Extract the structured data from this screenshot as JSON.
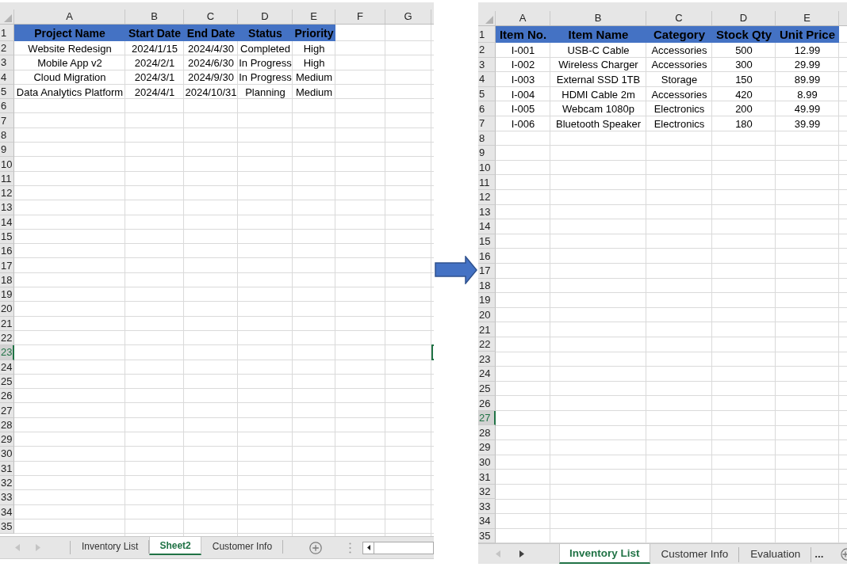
{
  "left_workbook": {
    "column_letters": [
      "A",
      "B",
      "C",
      "D",
      "E",
      "F",
      "G"
    ],
    "row_numbers": [
      {
        "label": "1",
        "selected": false
      },
      {
        "label": "2",
        "selected": false
      },
      {
        "label": "3",
        "selected": false
      },
      {
        "label": "4",
        "selected": false
      },
      {
        "label": "5",
        "selected": false
      },
      {
        "label": "6",
        "selected": false
      },
      {
        "label": "7",
        "selected": false
      },
      {
        "label": "8",
        "selected": false
      },
      {
        "label": "9",
        "selected": false
      },
      {
        "label": "10",
        "selected": false
      },
      {
        "label": "11",
        "selected": false
      },
      {
        "label": "12",
        "selected": false
      },
      {
        "label": "13",
        "selected": false
      },
      {
        "label": "14",
        "selected": false
      },
      {
        "label": "15",
        "selected": false
      },
      {
        "label": "16",
        "selected": false
      },
      {
        "label": "17",
        "selected": false
      },
      {
        "label": "18",
        "selected": false
      },
      {
        "label": "19",
        "selected": false
      },
      {
        "label": "20",
        "selected": false
      },
      {
        "label": "21",
        "selected": false
      },
      {
        "label": "22",
        "selected": false
      },
      {
        "label": "23",
        "selected": true
      },
      {
        "label": "24",
        "selected": false
      },
      {
        "label": "25",
        "selected": false
      },
      {
        "label": "26",
        "selected": false
      },
      {
        "label": "27",
        "selected": false
      },
      {
        "label": "28",
        "selected": false
      },
      {
        "label": "29",
        "selected": false
      },
      {
        "label": "30",
        "selected": false
      },
      {
        "label": "31",
        "selected": false
      },
      {
        "label": "32",
        "selected": false
      },
      {
        "label": "33",
        "selected": false
      },
      {
        "label": "34",
        "selected": false
      },
      {
        "label": "35",
        "selected": false
      }
    ],
    "table": {
      "columns": [
        "Project Name",
        "Start Date",
        "End Date",
        "Status",
        "Priority"
      ],
      "rows": [
        [
          "Website Redesign",
          "2024/1/15",
          "2024/4/30",
          "Completed",
          "High"
        ],
        [
          "Mobile App v2",
          "2024/2/1",
          "2024/6/30",
          "In Progress",
          "High"
        ],
        [
          "Cloud Migration",
          "2024/3/1",
          "2024/9/30",
          "In Progress",
          "Medium"
        ],
        [
          "Data Analytics Platform",
          "2024/4/1",
          "2024/10/31",
          "Planning",
          "Medium"
        ]
      ]
    },
    "active_cell_edge": true,
    "sheet_nav": {
      "prev_disabled": true,
      "next_disabled": true
    },
    "sheet_tabs": [
      {
        "label": "Inventory List",
        "selected": false
      },
      {
        "label": "Sheet2",
        "selected": true
      },
      {
        "label": "Customer Info",
        "selected": false
      }
    ]
  },
  "right_workbook": {
    "column_letters": [
      "A",
      "B",
      "C",
      "D",
      "E"
    ],
    "row_numbers": [
      {
        "label": "1",
        "selected": false
      },
      {
        "label": "2",
        "selected": false
      },
      {
        "label": "3",
        "selected": false
      },
      {
        "label": "4",
        "selected": false
      },
      {
        "label": "5",
        "selected": false
      },
      {
        "label": "6",
        "selected": false
      },
      {
        "label": "7",
        "selected": false
      },
      {
        "label": "8",
        "selected": false
      },
      {
        "label": "9",
        "selected": false
      },
      {
        "label": "10",
        "selected": false
      },
      {
        "label": "11",
        "selected": false
      },
      {
        "label": "12",
        "selected": false
      },
      {
        "label": "13",
        "selected": false
      },
      {
        "label": "14",
        "selected": false
      },
      {
        "label": "15",
        "selected": false
      },
      {
        "label": "16",
        "selected": false
      },
      {
        "label": "17",
        "selected": false
      },
      {
        "label": "18",
        "selected": false
      },
      {
        "label": "19",
        "selected": false
      },
      {
        "label": "20",
        "selected": false
      },
      {
        "label": "21",
        "selected": false
      },
      {
        "label": "22",
        "selected": false
      },
      {
        "label": "23",
        "selected": false
      },
      {
        "label": "24",
        "selected": false
      },
      {
        "label": "25",
        "selected": false
      },
      {
        "label": "26",
        "selected": false
      },
      {
        "label": "27",
        "selected": true
      },
      {
        "label": "28",
        "selected": false
      },
      {
        "label": "29",
        "selected": false
      },
      {
        "label": "30",
        "selected": false
      },
      {
        "label": "31",
        "selected": false
      },
      {
        "label": "32",
        "selected": false
      },
      {
        "label": "33",
        "selected": false
      },
      {
        "label": "34",
        "selected": false
      },
      {
        "label": "35",
        "selected": false
      }
    ],
    "table": {
      "columns": [
        "Item No.",
        "Item Name",
        "Category",
        "Stock Qty",
        "Unit Price"
      ],
      "rows": [
        [
          "I-001",
          "USB-C Cable",
          "Accessories",
          "500",
          "12.99"
        ],
        [
          "I-002",
          "Wireless Charger",
          "Accessories",
          "300",
          "29.99"
        ],
        [
          "I-003",
          "External SSD 1TB",
          "Storage",
          "150",
          "89.99"
        ],
        [
          "I-004",
          "HDMI Cable 2m",
          "Accessories",
          "420",
          "8.99"
        ],
        [
          "I-005",
          "Webcam 1080p",
          "Electronics",
          "200",
          "49.99"
        ],
        [
          "I-006",
          "Bluetooth Speaker",
          "Electronics",
          "180",
          "39.99"
        ]
      ]
    },
    "sheet_nav": {
      "prev_disabled": true,
      "next_disabled": false
    },
    "sheet_tabs": [
      {
        "label": "Inventory List",
        "selected": true
      },
      {
        "label": "Customer Info",
        "selected": false
      },
      {
        "label": "Evaluation",
        "selected": false
      }
    ],
    "more_tabs": "..."
  }
}
